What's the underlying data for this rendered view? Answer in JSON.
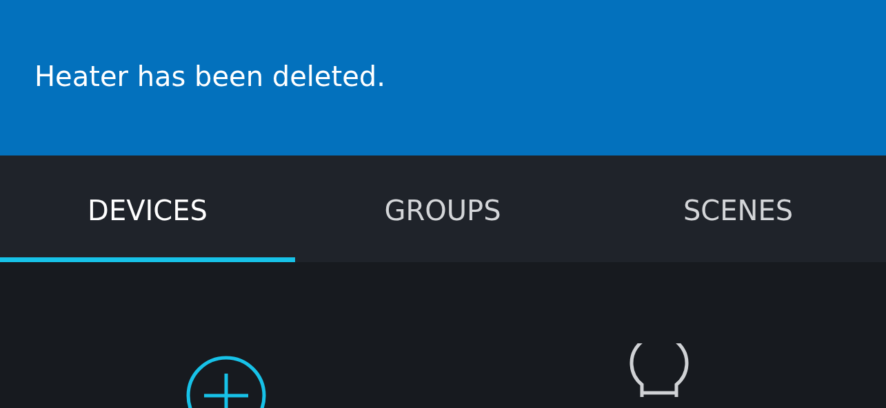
{
  "banner": {
    "message": "Heater has been deleted."
  },
  "tabs": [
    {
      "label": "DEVICES",
      "selected": true
    },
    {
      "label": "GROUPS",
      "selected": false
    },
    {
      "label": "SCENES",
      "selected": false
    }
  ],
  "content": {
    "items": [
      {
        "kind": "add"
      },
      {
        "kind": "bulb"
      }
    ]
  }
}
